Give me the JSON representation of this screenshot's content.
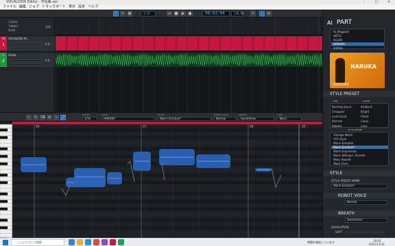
{
  "window": {
    "title": "VOCALOID6 Editor - 平坦曲.vpr"
  },
  "menu": [
    "ファイル",
    "編集",
    "ジョブ",
    "トラックポート",
    "表示",
    "設定",
    "ヘルプ"
  ],
  "toolbar": {
    "quantize": "1/16",
    "time": "98:02:04",
    "tempo": "120.00",
    "signature": "4/4"
  },
  "tracks": {
    "header_rows": [
      "TEMPO",
      "TIMING",
      "MAIN"
    ],
    "tempo_val": "120",
    "track1": {
      "number": "1",
      "name": "VOCALOID #1",
      "vol": "0.0"
    },
    "track2": {
      "number": "2",
      "name": "Audio",
      "vol": "0.0"
    }
  },
  "editor_toolbar": {
    "quant_label": "QUANT",
    "quant": "1/16",
    "voice_label": "VOICE",
    "voice": "HARUKA",
    "style_label": "STYLE",
    "style": "Warm Emotion*",
    "robot_label": "ROBOT VOICE",
    "robot": "Normal",
    "breath_label": "BREATH",
    "breath": "Sometimes",
    "take_label": "TAKE",
    "take": "Take1"
  },
  "measures": [
    "36",
    "37",
    "38",
    "39"
  ],
  "right": {
    "logo": "AI",
    "part_title": "PART",
    "voices": [
      "AI_Megpoid",
      "AKITO",
      "ALLEN",
      "HARUKA",
      "SARAH"
    ],
    "selected_voice": "HARUKA",
    "voicebank_name": "HARUKA",
    "voicebank_sub": "VOCALOID6",
    "style_preset_header": "STYLE PRESET",
    "type_label": "TYPE",
    "color_label": "COLOR",
    "types": [
      "Backing Vocal",
      "Chopped",
      "Lead Vocal",
      "Pitched",
      "Robotic"
    ],
    "colors": [
      "Ambient",
      "Bright",
      "Chest",
      "Clean",
      "Cute"
    ],
    "style_preset_label": "STYLE PRESET",
    "presets": [
      "Vintage Warm",
      "VY2 Style",
      "Warm Emotion",
      "Warm Emotion*",
      "Warm Expression",
      "Warm Whisper, Secrets",
      "Warp Repeat",
      "Warp Zone"
    ],
    "selected_preset": "Warm Emotion*",
    "style_header": "STYLE",
    "style_preset_name_label": "STYLE PRESET NAME",
    "style_preset_name": "Warm Emotion*",
    "robot_header": "ROBOT VOICE",
    "robot_mode": "Normal",
    "breath_header": "BREATH",
    "breath_mode": "Sometimes",
    "exhalation_label": "EXHALATION",
    "soft_label": "SOFT"
  },
  "taskbar": {
    "search_placeholder": "ここに入力して検索",
    "tray_text": "問題を確認しています",
    "clock_time": "18:02",
    "clock_date": "2021/11/11"
  },
  "colors": {
    "track1": "#c8163f",
    "track2": "#1f9a3a",
    "notes": "#2a63b8",
    "accent": "#1f6fb2"
  }
}
